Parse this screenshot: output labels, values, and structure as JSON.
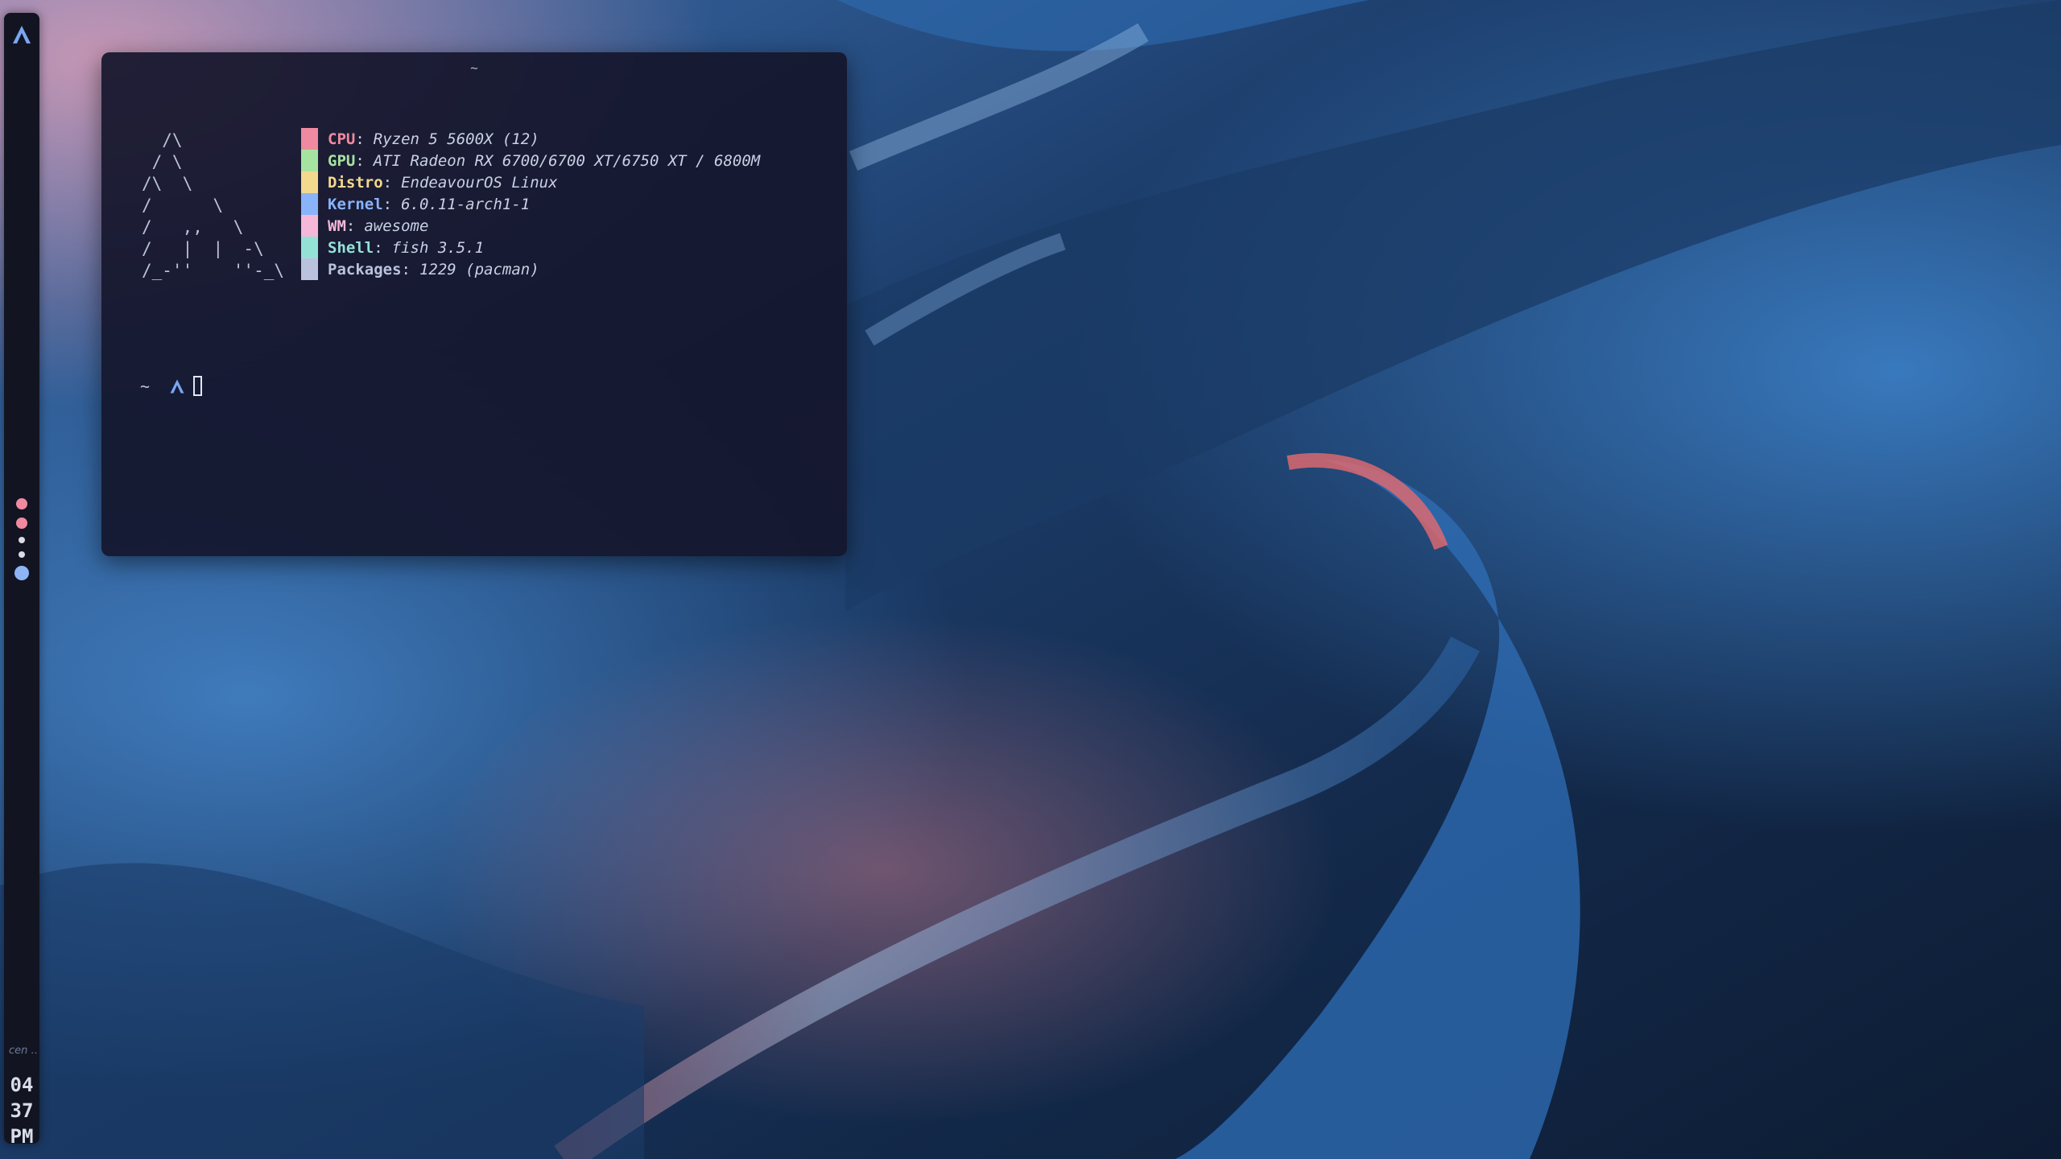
{
  "wallpaper": {
    "icon": "abstract-fractal-wallpaper",
    "colors": [
      "#0c1a2c",
      "#1e4a82",
      "#3a7bc6",
      "#e06a78"
    ]
  },
  "sidebar": {
    "launcher_icon": "endeavouros-logo-icon",
    "launcher_color": "#7aa7f0",
    "tags": [
      {
        "name": "tag-1",
        "color": "#f08aa0",
        "state": "occupied"
      },
      {
        "name": "tag-2",
        "color": "#f08aa0",
        "state": "occupied"
      },
      {
        "name": "tag-3",
        "color": "#d8dde8",
        "state": "empty"
      },
      {
        "name": "tag-4",
        "color": "#d8dde8",
        "state": "empty"
      },
      {
        "name": "tag-5",
        "color": "#8fb4f5",
        "state": "focused"
      }
    ],
    "task_label": "cen …",
    "clock": {
      "hour": "04",
      "minute": "37",
      "ampm": "PM",
      "color": "#d8dde8"
    }
  },
  "terminal": {
    "title": "~",
    "ascii_logo": "  /\\\n / \\\n/\\  \\\n/      \\\n/   ,,   \\\n/   |  |  -\\\n/_-''    ''-_\\",
    "info": [
      {
        "key": "CPU",
        "value": "Ryzen 5 5600X (12)",
        "color": "#f08aa0"
      },
      {
        "key": "GPU",
        "value": "ATI Radeon RX 6700/6700 XT/6750 XT / 6800M",
        "color": "#a6e3a1"
      },
      {
        "key": "Distro",
        "value": "EndeavourOS Linux",
        "color": "#f2d98e"
      },
      {
        "key": "Kernel",
        "value": "6.0.11-arch1-1",
        "color": "#89b4fa"
      },
      {
        "key": "WM",
        "value": "awesome",
        "color": "#f5b8d8"
      },
      {
        "key": "Shell",
        "value": "fish 3.5.1",
        "color": "#94e2d5"
      },
      {
        "key": "Packages",
        "value": "1229 (pacman)",
        "color": "#bac2de"
      }
    ],
    "separator": ":",
    "prompt": {
      "dir": "~",
      "icon": "endeavouros-prompt-icon",
      "icon_color": "#7aa7f0"
    }
  }
}
